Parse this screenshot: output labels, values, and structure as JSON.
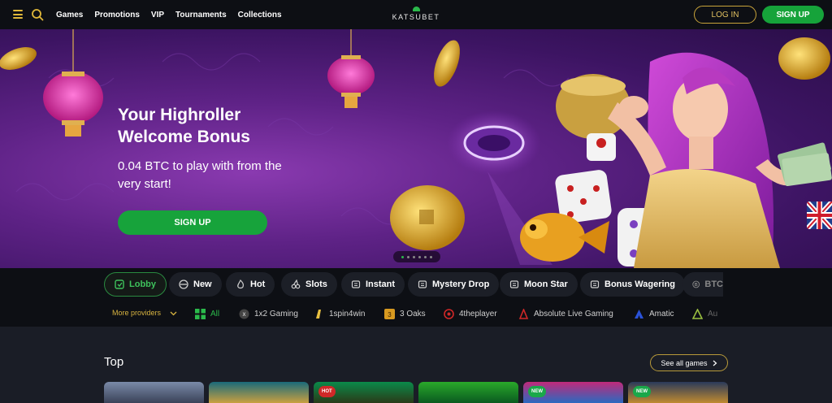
{
  "header": {
    "nav": [
      "Games",
      "Promotions",
      "VIP",
      "Tournaments",
      "Collections"
    ],
    "logo_text": "KATSUBET",
    "login_label": "LOG IN",
    "signup_label": "SIGN UP"
  },
  "hero": {
    "title": "Your Highroller Welcome Bonus",
    "subtitle": "0.04 BTC to play with from the very start!",
    "cta_label": "SIGN UP",
    "slide_count": 6,
    "active_slide": 1
  },
  "categories": [
    {
      "label": "Lobby",
      "icon": "lobby-icon",
      "active": true
    },
    {
      "label": "New",
      "icon": "new-icon"
    },
    {
      "label": "Hot",
      "icon": "flame-icon"
    },
    {
      "label": "Slots",
      "icon": "cherry-icon"
    },
    {
      "label": "Instant",
      "icon": "instant-icon"
    },
    {
      "label": "Mystery Drop",
      "icon": "drop-icon"
    },
    {
      "label": "Moon Star",
      "icon": "moon-icon"
    },
    {
      "label": "Bonus Wagering",
      "icon": "wager-icon"
    },
    {
      "label": "BTC",
      "icon": "btc-icon"
    }
  ],
  "providers": {
    "more_label": "More providers",
    "items": [
      "All",
      "1x2 Gaming",
      "1spin4win",
      "3 Oaks",
      "4theplayer",
      "Absolute Live Gaming",
      "Amatic",
      "Au"
    ]
  },
  "top_section": {
    "title": "Top",
    "see_all_label": "See all games",
    "badges": [
      "",
      "",
      "HOT",
      "",
      "NEW",
      "NEW"
    ]
  },
  "colors": {
    "accent_green": "#16a33a",
    "accent_gold": "#c9a43a",
    "header_bg": "#0d0f14",
    "hero_purple": "#5e2286"
  }
}
